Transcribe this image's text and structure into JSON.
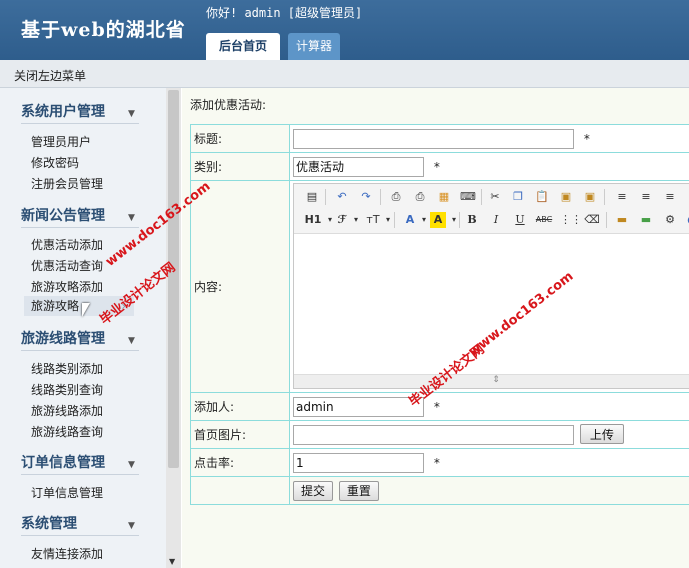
{
  "header": {
    "site_title": "基于web的湖北省",
    "greeting": "你好! admin [超级管理员]",
    "tabs": [
      {
        "label": "后台首页",
        "active": true
      },
      {
        "label": "计算器",
        "active": false
      }
    ]
  },
  "subbar": {
    "close_menu": "关闭左边菜单"
  },
  "sidebar": {
    "groups": [
      {
        "title": "系统用户管理",
        "items": [
          "管理员用户",
          "修改密码",
          "注册会员管理"
        ]
      },
      {
        "title": "新闻公告管理",
        "items": [
          "优惠活动添加",
          "优惠活动查询",
          "旅游攻略添加",
          "旅游攻略查询"
        ]
      },
      {
        "title": "旅游线路管理",
        "items": [
          "线路类别添加",
          "线路类别查询",
          "旅游线路添加",
          "旅游线路查询"
        ]
      },
      {
        "title": "订单信息管理",
        "items": [
          "订单信息管理"
        ]
      },
      {
        "title": "系统管理",
        "items": [
          "友情连接添加"
        ]
      }
    ],
    "hovered_item_label": "旅游攻略"
  },
  "main": {
    "title": "添加优惠活动:",
    "fields": {
      "title_label": "标题:",
      "title_value": "",
      "category_label": "类别:",
      "category_value": "优惠活动",
      "content_label": "内容:",
      "adder_label": "添加人:",
      "adder_value": "admin",
      "image_label": "首页图片:",
      "image_value": "",
      "upload_button": "上传",
      "clicks_label": "点击率:",
      "clicks_value": "1",
      "required_mark": "*"
    },
    "buttons": {
      "submit": "提交",
      "reset": "重置"
    },
    "editor_toolbar": {
      "heading": "H1",
      "font": "ℱ",
      "size": "ᴛT",
      "bold": "B",
      "italic": "I",
      "underline": "U",
      "strike": "ABC"
    }
  },
  "watermarks": [
    "毕业设计论文网",
    "www.doc163.com"
  ],
  "colors": {
    "header_bg": "#2e5d8c",
    "tab_inactive_bg": "#5d95c8",
    "table_border": "#8cdcdc",
    "watermark": "#d8161b"
  }
}
